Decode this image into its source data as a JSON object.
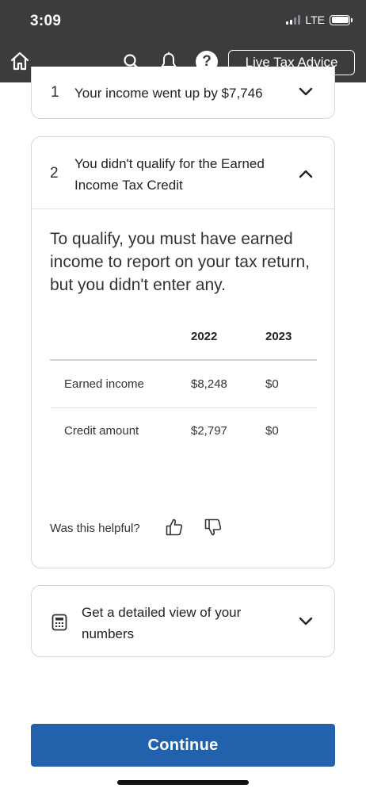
{
  "status_bar": {
    "time": "3:09",
    "network": "LTE"
  },
  "app_bar": {
    "help_label": "?",
    "live_advice_label": "Live Tax Advice",
    "icons": [
      "home-icon",
      "search-icon",
      "bell-icon",
      "help-icon"
    ]
  },
  "cards": {
    "income": {
      "number": "1",
      "title": "Your income went up by $7,746"
    },
    "eic": {
      "number": "2",
      "title": "You didn't qualify for the Earned Income Tax Credit",
      "explanation": "To qualify, you must have earned income to report on your tax return, but you didn't enter any.",
      "table": {
        "columns": [
          "2022",
          "2023"
        ],
        "rows": [
          {
            "label": "Earned income",
            "values": [
              "$8,248",
              "$0"
            ]
          },
          {
            "label": "Credit amount",
            "values": [
              "$2,797",
              "$0"
            ]
          }
        ]
      },
      "helpful_prompt": "Was this helpful?"
    },
    "detail": {
      "title": "Get a detailed view of your numbers",
      "icon": "calculator-icon"
    }
  },
  "continue_label": "Continue",
  "colors": {
    "header_bg": "#3c3c3e",
    "primary_button": "#2262ad",
    "card_border": "#d4d7dc"
  }
}
